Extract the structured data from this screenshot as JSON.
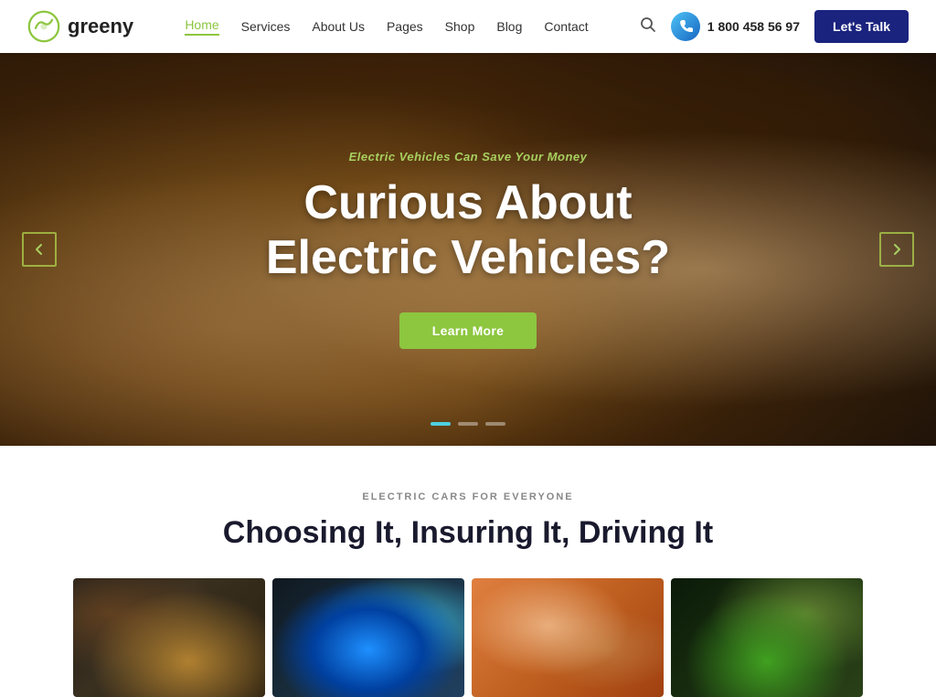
{
  "header": {
    "logo_text": "greeny",
    "nav": {
      "items": [
        {
          "label": "Home",
          "active": true
        },
        {
          "label": "Services"
        },
        {
          "label": "About Us"
        },
        {
          "label": "Pages"
        },
        {
          "label": "Shop"
        },
        {
          "label": "Blog"
        },
        {
          "label": "Contact"
        }
      ]
    },
    "phone": "1 800 458 56 97",
    "cta_label": "Let's Talk"
  },
  "hero": {
    "subtitle": "Electric Vehicles Can Save Your Money",
    "title_line1": "Curious About",
    "title_line2": "Electric Vehicles?",
    "cta_label": "Learn More",
    "arrow_left": "←",
    "arrow_right": "→",
    "dots": [
      {
        "active": true
      },
      {
        "active": false
      },
      {
        "active": false
      }
    ]
  },
  "section": {
    "eyebrow": "ELECTRIC CARS FOR EVERYONE",
    "title": "Choosing It, Insuring It, Driving It",
    "cards": [
      {
        "id": 1,
        "alt": "Car interior close-up"
      },
      {
        "id": 2,
        "alt": "EV charging connector"
      },
      {
        "id": 3,
        "alt": "Happy family in car"
      },
      {
        "id": 4,
        "alt": "Green plant close-up"
      }
    ]
  }
}
